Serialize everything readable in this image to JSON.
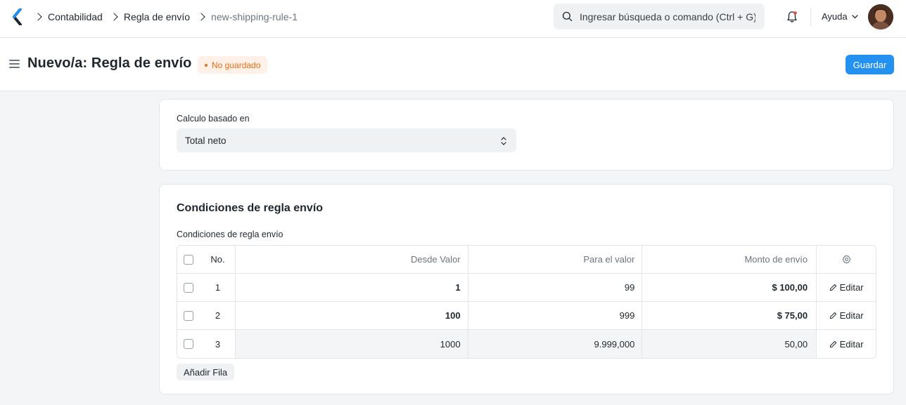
{
  "navbar": {
    "breadcrumbs": [
      "Contabilidad",
      "Regla de envío",
      "new-shipping-rule-1"
    ],
    "search_placeholder": "Ingresar búsqueda o comando (Ctrl + G)",
    "help_label": "Ayuda"
  },
  "header": {
    "title": "Nuevo/a: Regla de envío",
    "status_badge": "No guardado",
    "save_label": "Guardar"
  },
  "calculation": {
    "label": "Calculo basado en",
    "value": "Total neto"
  },
  "conditions": {
    "section_title": "Condiciones de regla envío",
    "table_label": "Condiciones de regla envío",
    "columns": {
      "no": "No.",
      "from": "Desde Valor",
      "to": "Para el valor",
      "amount": "Monto de envío"
    },
    "rows": [
      {
        "no": "1",
        "from": "1",
        "to": "99",
        "amount": "$ 100,00",
        "edit": "Editar"
      },
      {
        "no": "2",
        "from": "100",
        "to": "999",
        "amount": "$ 75,00",
        "edit": "Editar"
      },
      {
        "no": "3",
        "from": "1000",
        "to": "9.999,000",
        "amount": "50,00",
        "edit": "Editar"
      }
    ],
    "add_row_label": "Añadir Fila"
  },
  "colors": {
    "primary": "#2490ef",
    "badge_bg": "#fff1e7",
    "badge_text": "#e86c13"
  }
}
